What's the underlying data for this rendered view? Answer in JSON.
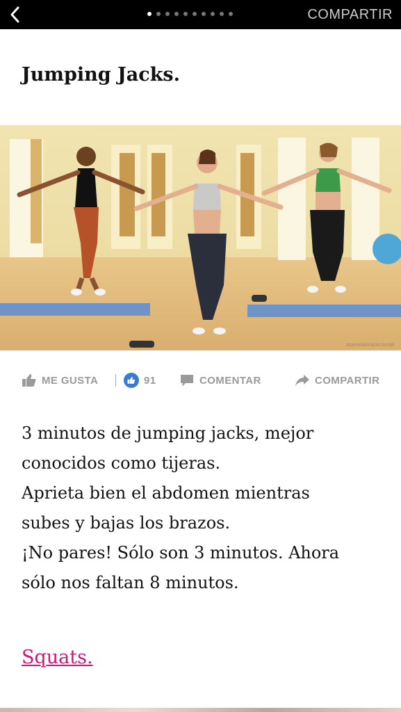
{
  "header": {
    "back_icon": "chevron-left-icon",
    "share_label": "COMPARTIR",
    "pager": {
      "total": 10,
      "active_index": 0
    }
  },
  "article": {
    "title": "Jumping Jacks.",
    "image": {
      "watermark": "itsamelabinacio.tumblr"
    },
    "actions": {
      "like_label": "ME GUSTA",
      "like_count": "91",
      "comment_label": "COMENTAR",
      "share_label": "COMPARTIR"
    },
    "body_lines": [
      "3 minutos de jumping jacks, mejor",
      "conocidos como tijeras.",
      "Aprieta bien el abdomen mientras",
      "subes y bajas los brazos.",
      "¡No pares! Sólo son 3 minutos. Ahora",
      "sólo nos faltan 8 minutos."
    ],
    "next_link": "Squats."
  },
  "colors": {
    "link": "#d0147a",
    "topbar": "#000000",
    "like_badge": "#3b7bd6"
  }
}
